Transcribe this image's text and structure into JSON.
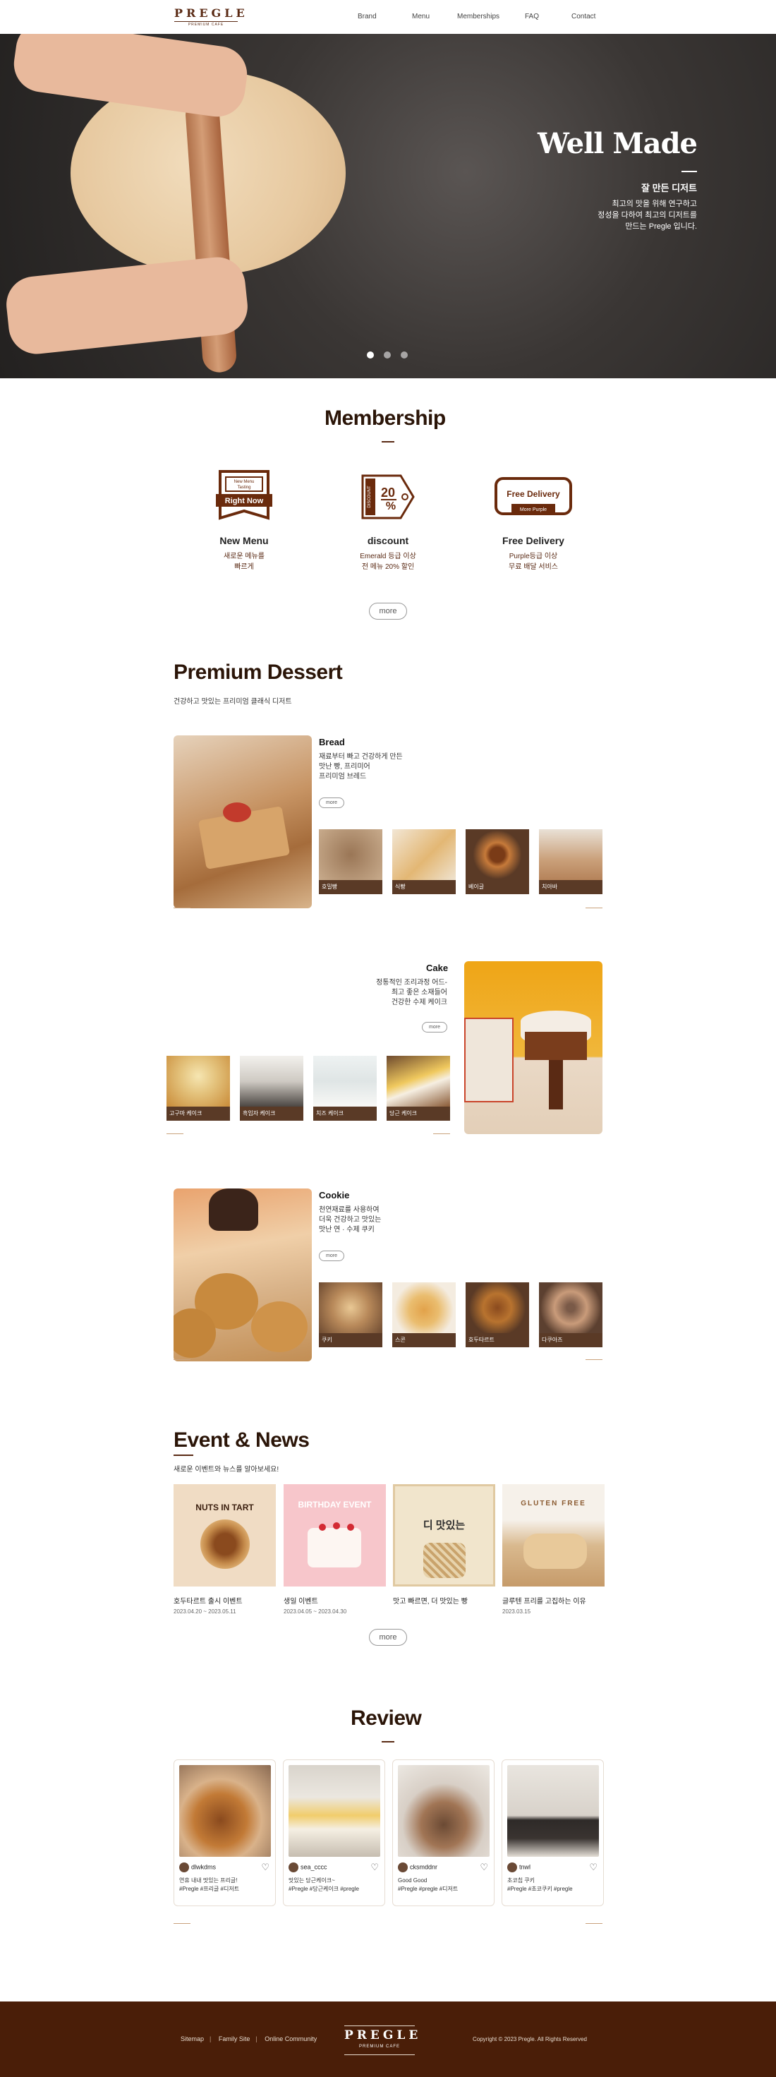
{
  "header": {
    "logo": "PREGLE",
    "logo_sub": "PREMIUM CAFE",
    "nav": [
      "Brand",
      "Menu",
      "Memberships",
      "FAQ",
      "Contact"
    ]
  },
  "hero": {
    "title": "Well Made",
    "subtitle": "잘 만든 디저트",
    "desc": "최고의 맛을 위해 연구하고\n정성을 다하여 최고의 디저트를\n만드는 Pregle 입니다.",
    "slides": 3,
    "active_slide": 1
  },
  "membership": {
    "title": "Membership",
    "items": [
      {
        "icon": "ticket-right-now-icon",
        "icon_small": "New Menu\nTasting",
        "icon_text": "Right Now",
        "title": "New Menu",
        "desc": "새로운 메뉴를\n빠르게"
      },
      {
        "icon": "discount-tag-icon",
        "icon_text": "20%",
        "icon_side": "DISCOUNT",
        "title": "discount",
        "desc": "Emerald 등급 이상\n전 메뉴 20% 할인"
      },
      {
        "icon": "free-delivery-card-icon",
        "icon_text": "Free Delivery",
        "icon_small": "More Purple",
        "title": "Free Delivery",
        "desc": "Purple등급 이상\n무료 배달 서비스"
      }
    ],
    "more": "more"
  },
  "premium": {
    "title": "Premium Dessert",
    "subtitle": "건강하고 맛있는 프리미엄 클래식 디저트",
    "categories": [
      {
        "title": "Bread",
        "desc": "재료부터 빠고 건강하게 만든\n맛난 빵, 프리미어\n프리미엄 브레드",
        "more": "more",
        "thumbs": [
          "호밀빵",
          "식빵",
          "베이글",
          "치아바"
        ]
      },
      {
        "title": "Cake",
        "desc": "정통적인 조리과정 어드-\n최고 좋은 소재들어\n건강한 수제 케이크",
        "more": "more",
        "thumbs": [
          "고구마 케이크",
          "흑임자 케이크",
          "치즈 케이크",
          "당근 케이크"
        ]
      },
      {
        "title": "Cookie",
        "desc": "천연재료를 사용하여\n더욱 건강하고 맛있는\n맛난 연 · 수제 쿠키",
        "more": "more",
        "thumbs": [
          "쿠키",
          "스콘",
          "호두타르트",
          "다쿠아즈"
        ]
      }
    ]
  },
  "events": {
    "title": "Event & News",
    "subtitle": "새로운 이벤트와 뉴스를 알아보세요!",
    "items": [
      {
        "img_text": "NUTS IN TART",
        "title": "호두타르트 출시 이벤트",
        "date": "2023.04.20 ~ 2023.05.11"
      },
      {
        "img_text": "BIRTHDAY EVENT",
        "title": "생일 이벤트",
        "date": "2023.04.05 ~ 2023.04.30"
      },
      {
        "img_text": "디 맛있는",
        "title": "맛고 빠르면, 더 맛있는 빵",
        "date": "2023.03.01"
      },
      {
        "img_text": "GLUTEN FREE",
        "title": "글루텐 프리를 고집하는 이유",
        "date": "2023.03.15"
      }
    ],
    "more": "more"
  },
  "review": {
    "title": "Review",
    "items": [
      {
        "user": "dlwkdms",
        "text": "연휴 내내 맛있는 프리글!\n#Pregle #프리글 #디저트"
      },
      {
        "user": "sea_cccc",
        "text": "맛있는 당근케이크~\n#Pregle #당근케이크 #pregle"
      },
      {
        "user": "cksmddnr",
        "text": "Good Good\n#Pregle #pregle #디저트"
      },
      {
        "user": "tnwl",
        "text": "초코칩 쿠키\n#Pregle #초코쿠키 #pregle"
      }
    ]
  },
  "footer": {
    "links": [
      "Sitemap",
      "Family Site",
      "Online Community"
    ],
    "logo": "PREGLE",
    "logo_sub": "PREMIUM CAFE",
    "copyright": "Copyright © 2023 Pregle. All Rights Reserved"
  }
}
